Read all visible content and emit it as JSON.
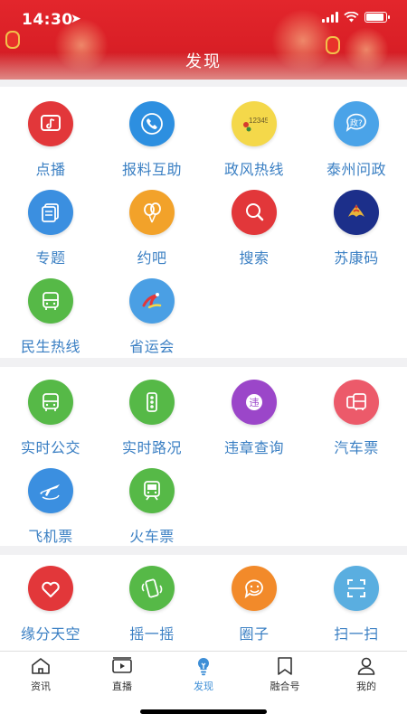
{
  "status_bar": {
    "time": "14:30"
  },
  "header": {
    "title": "发现"
  },
  "sections": [
    {
      "items": [
        {
          "label": "点播",
          "icon": "music-video-icon",
          "color": "#e2373a"
        },
        {
          "label": "报料互助",
          "icon": "phone-icon",
          "color": "#2d8fe0"
        },
        {
          "label": "政风热线",
          "icon": "hotline-12345-icon",
          "color": "#f4d84a",
          "icon_text": "12345"
        },
        {
          "label": "泰州问政",
          "icon": "government-question-icon",
          "color": "#4aa3e8",
          "icon_text": "政?"
        },
        {
          "label": "专题",
          "icon": "topic-icon",
          "color": "#3b8fe0"
        },
        {
          "label": "约吧",
          "icon": "balloon-icon",
          "color": "#f2a22a"
        },
        {
          "label": "搜索",
          "icon": "search-icon",
          "color": "#e2373a"
        },
        {
          "label": "苏康码",
          "icon": "phoenix-logo-icon",
          "color": "#1c2f8a"
        },
        {
          "label": "民生热线",
          "icon": "bus-icon",
          "color": "#56b947"
        },
        {
          "label": "省运会",
          "icon": "games-logo-icon",
          "color": "#4a9fe4"
        }
      ]
    },
    {
      "items": [
        {
          "label": "实时公交",
          "icon": "bus-icon",
          "color": "#56b947"
        },
        {
          "label": "实时路况",
          "icon": "traffic-light-icon",
          "color": "#56b947"
        },
        {
          "label": "违章查询",
          "icon": "violation-icon",
          "color": "#9b46c9",
          "icon_text": "违"
        },
        {
          "label": "汽车票",
          "icon": "coach-ticket-icon",
          "color": "#ec5a6a"
        },
        {
          "label": "飞机票",
          "icon": "airplane-icon",
          "color": "#3b8fe0"
        },
        {
          "label": "火车票",
          "icon": "train-icon",
          "color": "#56b947"
        }
      ]
    },
    {
      "items": [
        {
          "label": "缘分天空",
          "icon": "heart-icon",
          "color": "#e2373a"
        },
        {
          "label": "摇一摇",
          "icon": "shake-phone-icon",
          "color": "#56b947"
        },
        {
          "label": "圈子",
          "icon": "smile-chat-icon",
          "color": "#f28a2a"
        },
        {
          "label": "扫一扫",
          "icon": "scan-icon",
          "color": "#5aaee0"
        }
      ]
    }
  ],
  "tabbar": {
    "active_color": "#3d8ed6",
    "items": [
      {
        "label": "资讯",
        "icon": "home-icon"
      },
      {
        "label": "直播",
        "icon": "live-tv-icon"
      },
      {
        "label": "发现",
        "icon": "discover-bulb-icon",
        "active": true
      },
      {
        "label": "融合号",
        "icon": "bookmark-icon"
      },
      {
        "label": "我的",
        "icon": "person-icon"
      }
    ]
  }
}
